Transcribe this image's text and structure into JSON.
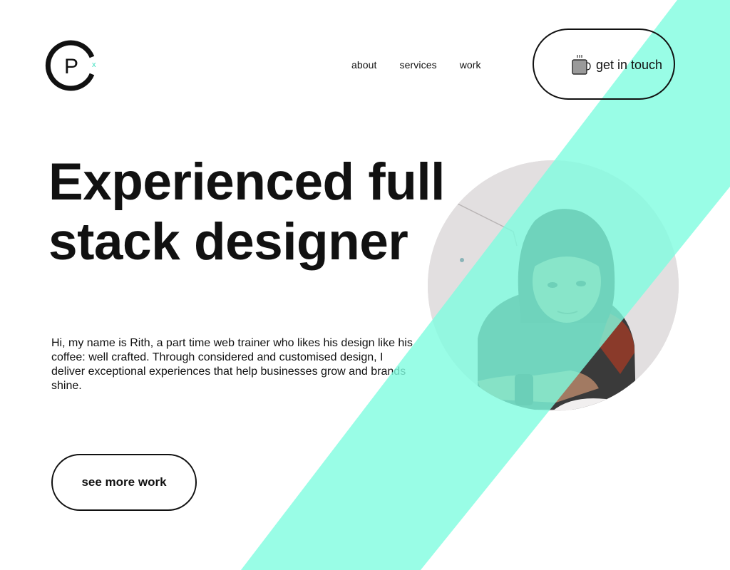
{
  "brand": {
    "logo_letter": "P",
    "logo_mark": "x"
  },
  "nav": {
    "items": [
      {
        "label": "about"
      },
      {
        "label": "services"
      },
      {
        "label": "work"
      }
    ]
  },
  "cta": {
    "label": "get in touch",
    "icon": "coffee-mug-icon"
  },
  "hero": {
    "title_line1": "Experienced full",
    "title_line2": "stack designer",
    "intro": "Hi, my name is Rith, a part time web trainer who likes his design like his coffee: well crafted. Through considered and customised design, I deliver exceptional experiences that help businesses grow and brands shine.",
    "button_label": "see more work"
  },
  "colors": {
    "accent": "#80fde0",
    "text": "#111111",
    "background": "#ffffff",
    "portrait_bg": "#e2dfe0"
  }
}
